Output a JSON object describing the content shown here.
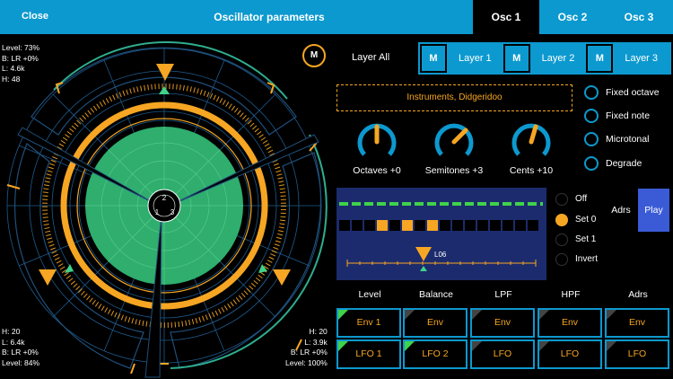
{
  "topbar": {
    "close": "Close",
    "title": "Oscillator parameters",
    "tabs": [
      {
        "label": "Osc 1",
        "active": true
      },
      {
        "label": "Osc 2",
        "active": false
      },
      {
        "label": "Osc 3",
        "active": false
      }
    ]
  },
  "radial": {
    "m_button": "M",
    "center_labels": [
      "1",
      "2",
      "3"
    ],
    "info_top_left": [
      "Level: 73%",
      "B: LR +0%",
      "L: 4.6k",
      "H: 48"
    ],
    "info_bottom_left": [
      "H: 20",
      "L: 6.4k",
      "B: LR +0%",
      "Level: 84%"
    ],
    "info_bottom_right": [
      "H: 20",
      "L: 3.9k",
      "B: LR +0%",
      "Level: 100%"
    ]
  },
  "layers": {
    "all_label": "Layer All",
    "items": [
      {
        "m": "M",
        "label": "Layer 1"
      },
      {
        "m": "M",
        "label": "Layer 2"
      },
      {
        "m": "M",
        "label": "Layer 3"
      }
    ]
  },
  "preset": "Instruments, Didgeridoo",
  "options": [
    "Fixed octave",
    "Fixed note",
    "Microtonal",
    "Degrade"
  ],
  "knobs": [
    {
      "label": "Octaves +0",
      "value": 0
    },
    {
      "label": "Semitones +3",
      "value": 3
    },
    {
      "label": "Cents +10",
      "value": 10
    }
  ],
  "sequencer": {
    "steps_on": [
      2,
      4,
      6
    ],
    "step_count": 16,
    "marker_label": "L06",
    "modes": [
      "Off",
      "Set 0",
      "Set 1",
      "Invert"
    ],
    "selected_mode": "Set 0",
    "adrs": "Adrs",
    "play": "Play"
  },
  "matrix": {
    "columns": [
      "Level",
      "Balance",
      "LPF",
      "HPF",
      "Adrs"
    ],
    "row1": [
      {
        "label": "Env 1",
        "active": true
      },
      {
        "label": "Env",
        "active": false
      },
      {
        "label": "Env",
        "active": false
      },
      {
        "label": "Env",
        "active": false
      },
      {
        "label": "Env",
        "active": false
      }
    ],
    "row2": [
      {
        "label": "LFO 1",
        "active": true
      },
      {
        "label": "LFO 2",
        "active": true
      },
      {
        "label": "LFO",
        "active": false
      },
      {
        "label": "LFO",
        "active": false
      },
      {
        "label": "LFO",
        "active": false
      }
    ]
  },
  "colors": {
    "accent_blue": "#0c99cf",
    "orange": "#f6a623",
    "green": "#3fd24a",
    "seq_bg": "#1c2b6e",
    "play_bg": "#3b5bd6"
  }
}
